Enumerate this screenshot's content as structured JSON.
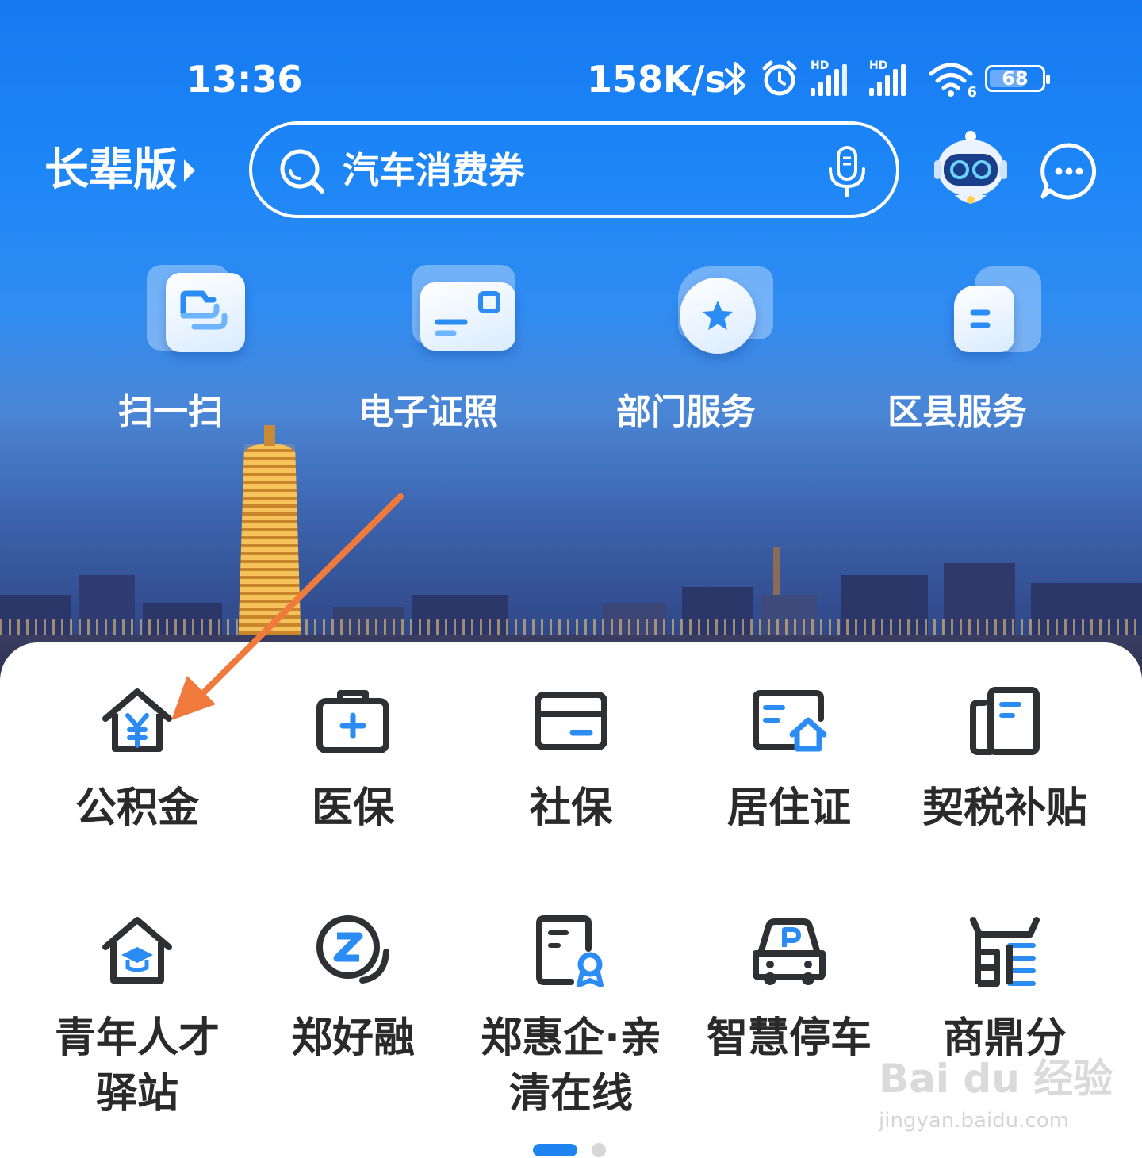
{
  "status_bar": {
    "time": "13:36",
    "net_speed": "158K/s",
    "signal_1_label": "HD",
    "signal_2_label": "HD",
    "wifi_label": "6",
    "battery": "68"
  },
  "header": {
    "elder_mode_label": "长辈版",
    "search_placeholder": "汽车消费券"
  },
  "quick_actions": [
    {
      "label": "扫一扫",
      "icon": "scan-icon"
    },
    {
      "label": "电子证照",
      "icon": "e-license-icon"
    },
    {
      "label": "部门服务",
      "icon": "department-service-icon"
    },
    {
      "label": "区县服务",
      "icon": "district-service-icon"
    }
  ],
  "services": [
    {
      "label": "公积金",
      "icon": "housing-fund-icon"
    },
    {
      "label": "医保",
      "icon": "medical-insurance-icon"
    },
    {
      "label": "社保",
      "icon": "social-security-icon"
    },
    {
      "label": "居住证",
      "icon": "residence-permit-icon"
    },
    {
      "label": "契税补贴",
      "icon": "deed-tax-subsidy-icon"
    },
    {
      "label_line1": "青年人才",
      "label_line2": "驿站",
      "icon": "youth-talent-icon"
    },
    {
      "label": "郑好融",
      "icon": "zheng-hao-rong-icon"
    },
    {
      "label_line1": "郑惠企·亲",
      "label_line2": "清在线",
      "icon": "enterprise-online-icon"
    },
    {
      "label": "智慧停车",
      "icon": "smart-parking-icon"
    },
    {
      "label": "商鼎分",
      "icon": "shangding-score-icon"
    }
  ],
  "pagination": {
    "current": 1,
    "total": 2
  },
  "watermark": {
    "brand": "Bai du 经验",
    "url": "jingyan.baidu.com"
  },
  "colors": {
    "accent": "#1f84f0",
    "arrow": "#f07a3c",
    "text": "#2a2a2a"
  }
}
